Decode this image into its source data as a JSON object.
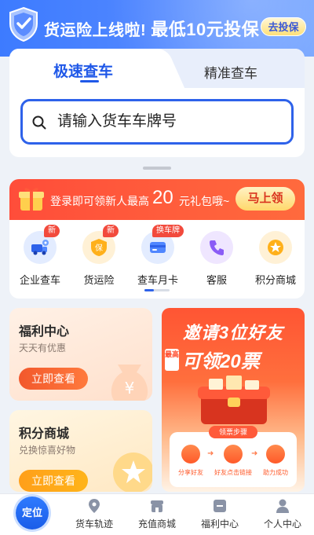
{
  "banner": {
    "text": "货运险上线啦!",
    "highlight": "最低10元投保",
    "button": "去投保"
  },
  "query": {
    "tabs": [
      {
        "label": "极速查车",
        "active": true
      },
      {
        "label": "精准查车",
        "active": false
      }
    ],
    "search": {
      "placeholder": "请输入货车车牌号",
      "value": ""
    }
  },
  "promo": {
    "text_before": "登录即可领新人最高",
    "amount": "20",
    "text_after": "元礼包哦~",
    "button": "马上领"
  },
  "services": [
    {
      "label": "企业查车",
      "badge": "新",
      "icon": "truck-location-icon"
    },
    {
      "label": "货运险",
      "badge": "新",
      "icon": "insurance-icon"
    },
    {
      "label": "查车月卡",
      "badge": "换车牌",
      "icon": "card-icon"
    },
    {
      "label": "客服",
      "badge": "",
      "icon": "customer-service-icon"
    },
    {
      "label": "积分商城",
      "badge": "",
      "icon": "points-icon"
    }
  ],
  "cards": {
    "welfare": {
      "title": "福利中心",
      "subtitle": "天天有优惠",
      "button": "立即查看"
    },
    "points": {
      "title": "积分商城",
      "subtitle": "兑换惊喜好物",
      "button": "立即查看"
    }
  },
  "invite": {
    "title": "邀请3位好友",
    "tag": "最高",
    "subtitle": "可领20票",
    "steps_title": "领票步骤",
    "steps": [
      "分享好友",
      "好友点击链接",
      "助力成功"
    ]
  },
  "nav": {
    "locate": "定位",
    "items": [
      "货车轨迹",
      "充值商城",
      "福利中心",
      "个人中心"
    ]
  },
  "colors": {
    "primary": "#2e62ea",
    "promo_red": "#ff4d3a",
    "orange": "#f2582c"
  }
}
